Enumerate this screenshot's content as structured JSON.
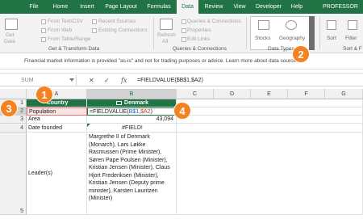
{
  "ribbon_tabs": [
    {
      "label": "File"
    },
    {
      "label": "Home"
    },
    {
      "label": "Insert"
    },
    {
      "label": "Page Layout"
    },
    {
      "label": "Formulas"
    },
    {
      "label": "Data"
    },
    {
      "label": "Review"
    },
    {
      "label": "View"
    },
    {
      "label": "Developer"
    },
    {
      "label": "Help"
    },
    {
      "label": "PROFESSOR EXCEL"
    }
  ],
  "ribbon": {
    "get_data": "Get",
    "get_data2": "Data",
    "from_text_csv": "From Text/CSV",
    "from_web": "From Web",
    "from_table_range": "From Table/Range",
    "recent_sources": "Recent Sources",
    "existing_connections": "Existing Connections",
    "refresh": "Refresh",
    "refresh_all": "All",
    "queries_connections": "Queries & Connections",
    "properties": "Properties",
    "edit_links": "Edit Links",
    "stocks": "Stocks",
    "geography": "Geography",
    "sort": "Sort",
    "filter": "Filter",
    "group_get_transform": "Get & Transform Data",
    "group_queries": "Queries & Connections",
    "group_data_types": "Data Types",
    "group_sort": "Sort & F"
  },
  "infobar": {
    "message": "Financial market information is provided \"as-is\" and not for trading purposes or advice. Learn more about data sources..."
  },
  "formula_bar": {
    "name_box": "SUM",
    "cancel": "✕",
    "enter": "✓",
    "fx": "fx",
    "formula": "=FIELDVALUE($B$1,$A2)"
  },
  "grid": {
    "columns": [
      "A",
      "B",
      "C",
      "D",
      "E",
      "F",
      "G"
    ],
    "rows": [
      "1",
      "2",
      "3",
      "4",
      "5"
    ],
    "a1": "Country",
    "b1": "Denmark",
    "a2": "Population",
    "b2_prefix": "=FIELDVALUE(",
    "b2_ref1": "B$1",
    "b2_sep": ",",
    "b2_ref2": "$A2",
    "b2_suffix": ")",
    "a3": "Area",
    "b3": "43,094",
    "a4": "Date founded",
    "b4": "#FIELD!",
    "a5": "Leader(s)",
    "b5": "Margrethe II of Denmark (Monarch), Lars Løkke Rasmussen (Prime Minister), Søren Pape Poulsen (Minister), Kristian Jensen (Minister), Claus Hjort Frederiksen (Minister), Kristian Jensen (Deputy prime minister), Karsten Lauritzen (Minister)"
  },
  "callouts": [
    "1",
    "2",
    "3",
    "4"
  ],
  "colors": {
    "excel_green": "#217346",
    "callout_orange": "#f58220",
    "ref_blue": "#1f5fbf",
    "ref_red": "#c0392b"
  }
}
